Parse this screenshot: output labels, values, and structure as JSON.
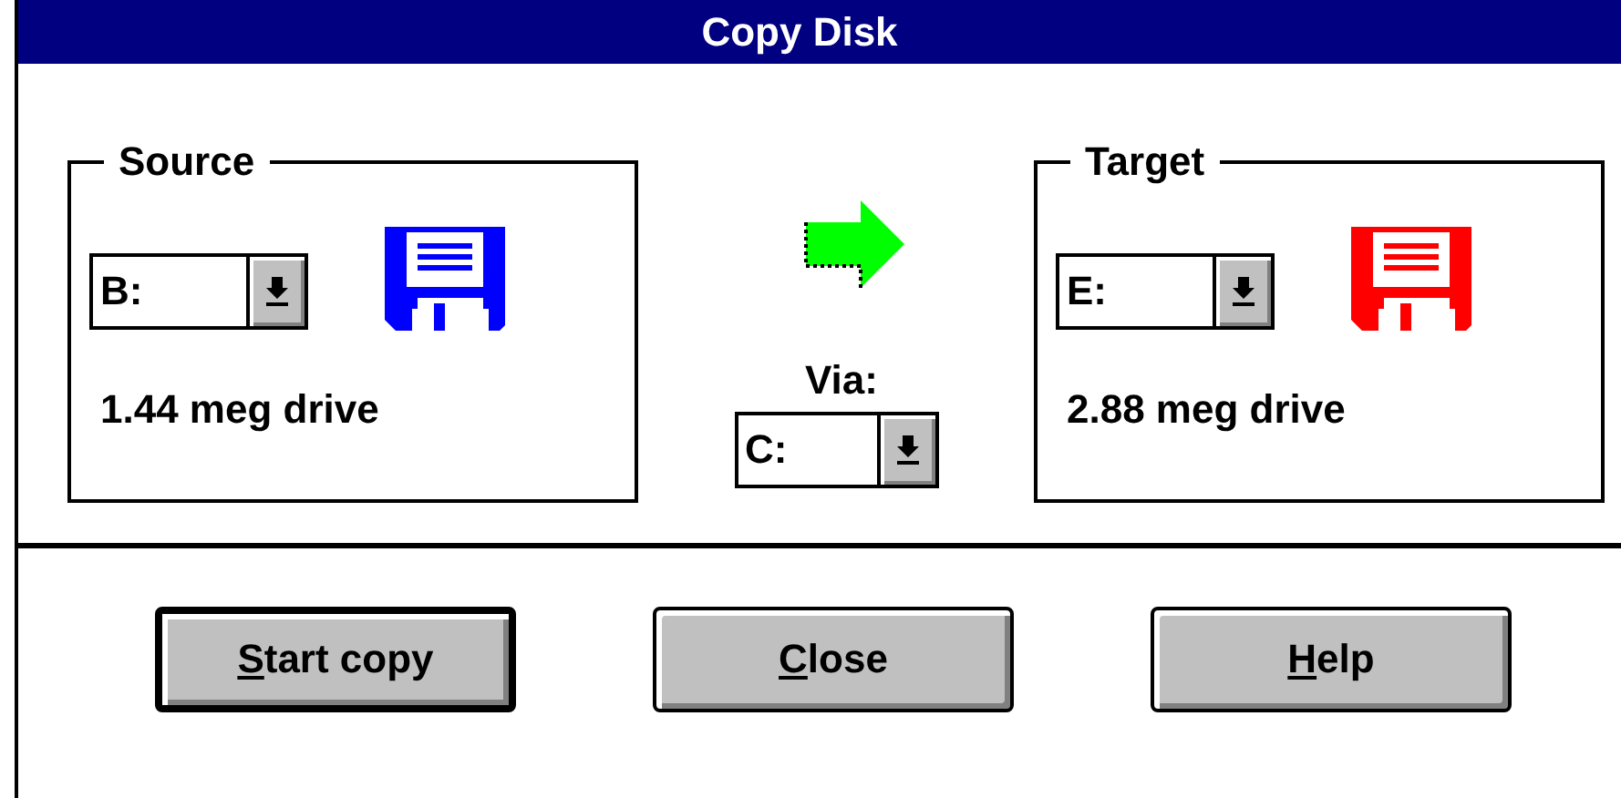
{
  "window": {
    "title": "Copy Disk"
  },
  "drives": [
    {
      "label": "Source",
      "value": "B:",
      "description": "1.44 meg drive",
      "color": "#0000ff"
    },
    {
      "label": "Target",
      "value": "E:",
      "description": "2.88 meg drive",
      "color": "#ff0000"
    }
  ],
  "via": {
    "label": "Via:",
    "value": "C:"
  },
  "buttons": [
    {
      "mnemonic": "S",
      "rest": "tart copy",
      "default": true
    },
    {
      "mnemonic": "C",
      "rest": "lose",
      "default": false
    },
    {
      "mnemonic": "H",
      "rest": "elp",
      "default": false
    }
  ]
}
